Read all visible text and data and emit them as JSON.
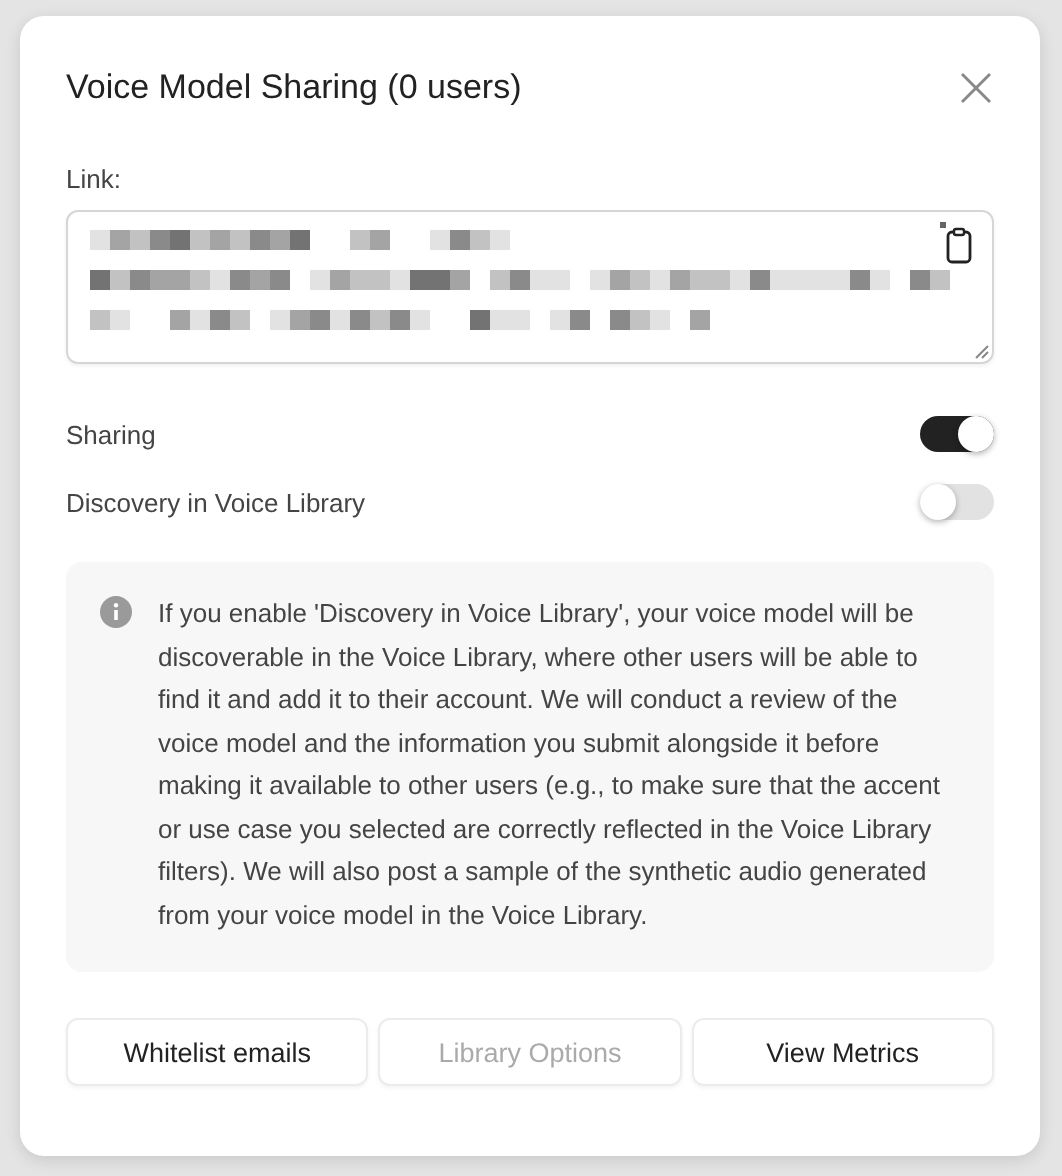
{
  "dialog": {
    "title": "Voice Model Sharing (0 users)"
  },
  "link": {
    "label": "Link:"
  },
  "toggles": [
    {
      "label": "Sharing",
      "on": true
    },
    {
      "label": "Discovery in Voice Library",
      "on": false
    }
  ],
  "info": {
    "text": "If you enable 'Discovery in Voice Library', your voice model will be discoverable in the Voice Library, where other users will be able to find it and add it to their account. We will conduct a review of the voice model and the information you submit alongside it before making it available to other users (e.g., to make sure that the accent or use case you selected are correctly reflected in the Voice Library filters). We will also post a sample of the synthetic audio generated from your voice model in the Voice Library."
  },
  "buttons": [
    {
      "label": "Whitelist emails",
      "disabled": false
    },
    {
      "label": "Library Options",
      "disabled": true
    },
    {
      "label": "View Metrics",
      "disabled": false
    }
  ]
}
